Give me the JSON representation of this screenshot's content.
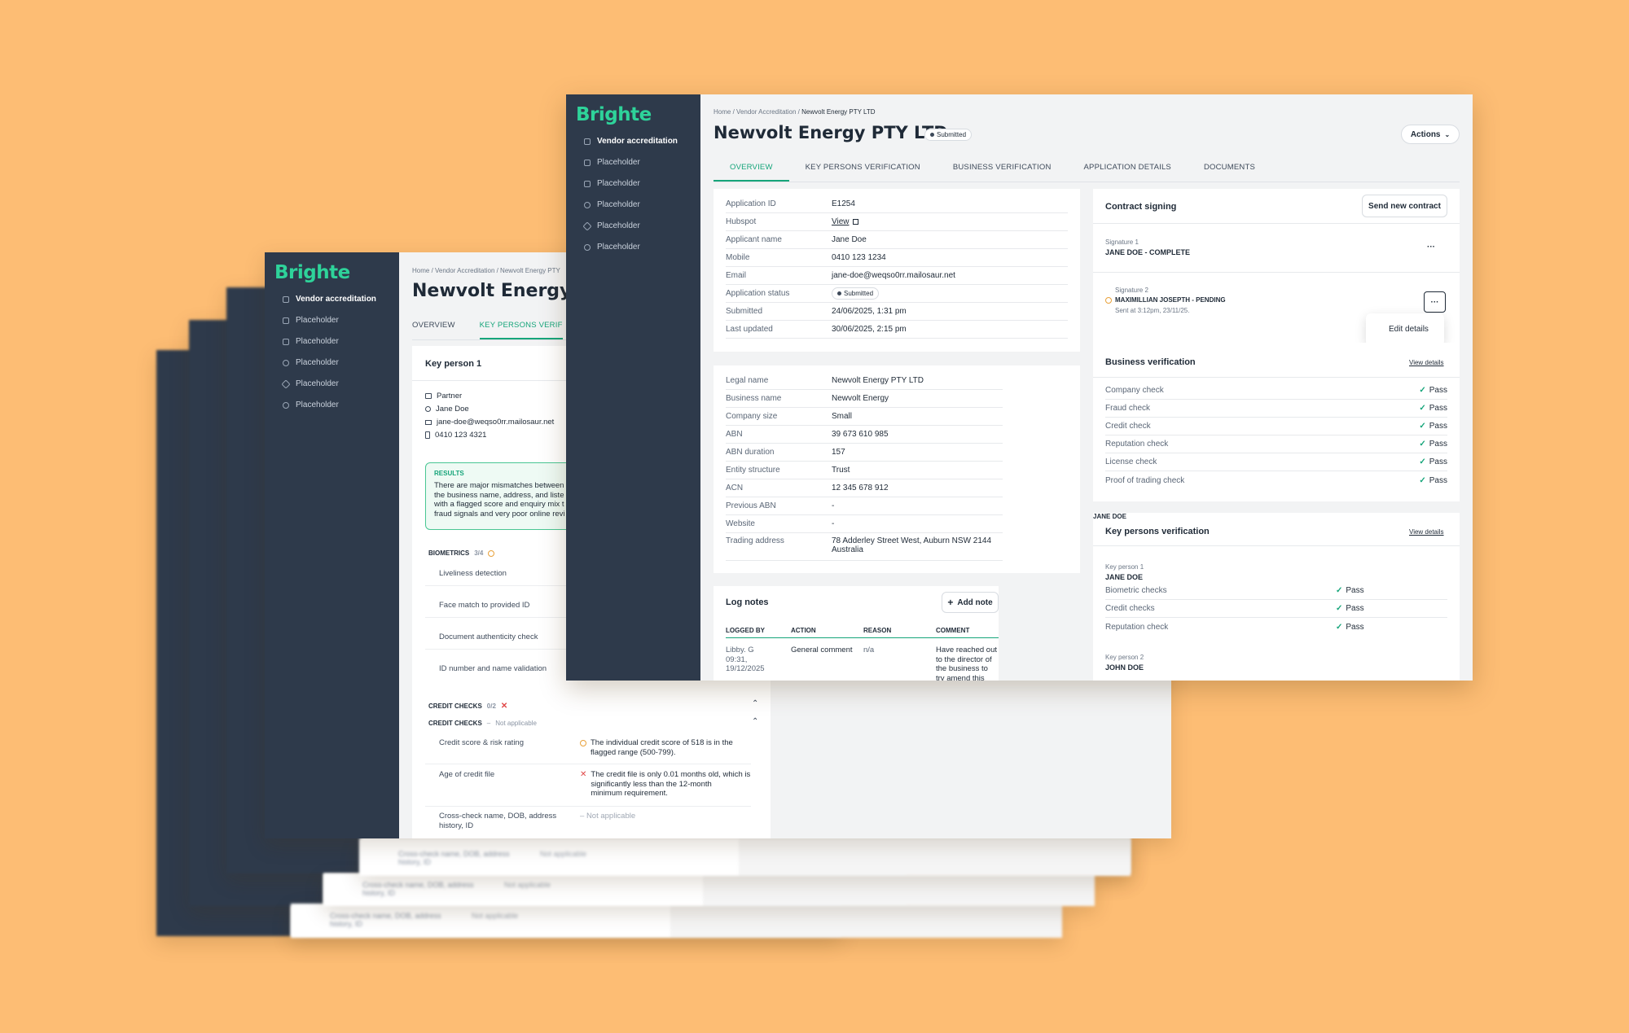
{
  "brand": {
    "logo": "Brighte",
    "accent": "#16a57a",
    "sidebar_bg": "#2e3a4b",
    "background": "#fdbd74"
  },
  "sidebar": {
    "items": [
      {
        "label": "Vendor accreditation",
        "icon": "shield-icon"
      },
      {
        "label": "Placeholder",
        "icon": "box-icon"
      },
      {
        "label": "Placeholder",
        "icon": "document-icon"
      },
      {
        "label": "Placeholder",
        "icon": "user-icon"
      },
      {
        "label": "Placeholder",
        "icon": "sparkle-icon"
      },
      {
        "label": "Placeholder",
        "icon": "settings-icon"
      }
    ]
  },
  "main": {
    "breadcrumb": {
      "home": "Home",
      "section": "Vendor Accreditation",
      "current": "Newvolt Energy PTY LTD",
      "sep": "/"
    },
    "title": "Newvolt Energy PTY LTD",
    "status_badge": "Submitted",
    "actions_label": "Actions",
    "tabs": [
      {
        "label": "OVERVIEW"
      },
      {
        "label": "KEY PERSONS VERIFICATION"
      },
      {
        "label": "BUSINESS VERIFICATION"
      },
      {
        "label": "APPLICATION DETAILS"
      },
      {
        "label": "DOCUMENTS"
      }
    ],
    "application": {
      "rows": [
        {
          "k": "Application ID",
          "v": "E1254"
        },
        {
          "k": "Hubspot",
          "v": "View"
        },
        {
          "k": "Applicant name",
          "v": "Jane Doe"
        },
        {
          "k": "Mobile",
          "v": "0410 123 1234"
        },
        {
          "k": "Email",
          "v": "jane-doe@weqso0rr.mailosaur.net"
        },
        {
          "k": "Application status",
          "v": "Submitted"
        },
        {
          "k": "Submitted",
          "v": "24/06/2025, 1:31 pm"
        },
        {
          "k": "Last updated",
          "v": "30/06/2025, 2:15 pm"
        }
      ]
    },
    "business": {
      "rows": [
        {
          "k": "Legal name",
          "v": "Newvolt Energy PTY LTD"
        },
        {
          "k": "Business name",
          "v": "Newvolt Energy"
        },
        {
          "k": "Company size",
          "v": "Small"
        },
        {
          "k": "ABN",
          "v": "39 673 610 985"
        },
        {
          "k": "ABN duration",
          "v": "157"
        },
        {
          "k": "Entity structure",
          "v": "Trust"
        },
        {
          "k": "ACN",
          "v": "12 345 678 912"
        },
        {
          "k": "Previous ABN",
          "v": "-"
        },
        {
          "k": "Website",
          "v": "-"
        },
        {
          "k": "Trading address",
          "v": "78 Adderley Street West, Auburn NSW 2144",
          "v2": "Australia"
        }
      ]
    },
    "log_notes": {
      "title": "Log notes",
      "add_label": "Add note",
      "headers": [
        "LOGGED BY",
        "ACTION",
        "REASON",
        "COMMENT"
      ],
      "row": {
        "by": "Libby. G",
        "by_time": "09:31,",
        "by_date": "19/12/2025",
        "action": "General comment",
        "reason": "n/a",
        "comment1": "Have reached out",
        "comment2": "to the director of",
        "comment3": "the business to",
        "comment4": "try amend this"
      }
    },
    "contract": {
      "title": "Contract signing",
      "send_label": "Send new contract",
      "sig1_label": "Signature 1",
      "sig1_value": "JANE DOE - COMPLETE",
      "sig2_label": "Signature 2",
      "sig2_value": "MAXIMILLIAN JOSEPTH - PENDING",
      "sig2_sent": "Sent at 3:12pm, 23/11/25.",
      "more": "···",
      "menu_item": "Edit details"
    },
    "business_verification": {
      "title": "Business verification",
      "link": "View details",
      "checks": [
        {
          "label": "Company check",
          "result": "Pass"
        },
        {
          "label": "Fraud check",
          "result": "Pass"
        },
        {
          "label": "Credit check",
          "result": "Pass"
        },
        {
          "label": "Reputation check",
          "result": "Pass"
        },
        {
          "label": "License check",
          "result": "Pass"
        },
        {
          "label": "Proof of trading check",
          "result": "Pass"
        }
      ]
    },
    "key_persons": {
      "title": "Key persons verification",
      "link": "View details",
      "kp1_label": "Key person 1",
      "kp1_name": "JANE DOE",
      "checks": [
        {
          "label": "Biometric checks",
          "result": "Pass"
        },
        {
          "label": "Credit checks",
          "result": "Pass"
        },
        {
          "label": "Reputation check",
          "result": "Pass"
        }
      ],
      "kp2_label": "Key person 2",
      "kp2_name": "JOHN DOE"
    }
  },
  "second": {
    "breadcrumb": "Home / Vendor Accreditation / Newvolt Energy PTY",
    "title": "Newvolt Energy PT",
    "tabs": [
      "OVERVIEW",
      "KEY PERSONS VERIF"
    ],
    "key_person_title": "Key person 1",
    "kp_details": [
      {
        "icon": "briefcase-icon",
        "text": "Partner"
      },
      {
        "icon": "user-icon",
        "text": "Jane Doe"
      },
      {
        "icon": "mail-icon",
        "text": "jane-doe@weqso0rr.mailosaur.net"
      },
      {
        "icon": "phone-icon",
        "text": "0410 123 4321"
      }
    ],
    "results_label": "RESULTS",
    "results_lines": [
      "There are major mismatches between",
      "the business name, address, and liste",
      "with a flagged score and enquiry mix t",
      "fraud signals and very poor online revi"
    ],
    "biometrics_label": "BIOMETRICS",
    "biometrics_count": "3/4",
    "biometric_items": [
      "Liveliness detection",
      "Face match to provided ID",
      "Document authenticity check",
      "ID number and name validation"
    ],
    "credit_checks_1": {
      "label": "CREDIT CHECKS",
      "count": "0/2"
    },
    "credit_checks_2": {
      "label": "CREDIT CHECKS",
      "note": "Not applicable"
    },
    "credit_rows": [
      {
        "k": "Credit score & risk rating",
        "v1": "The individual credit score of 518 is in the",
        "v2": "flagged range (500-799).",
        "v3": ""
      },
      {
        "k": "Age of credit file",
        "v1": "The credit file is only 0.01 months old, which is",
        "v2": "significantly less than the 12-month",
        "v3": "minimum requirement."
      },
      {
        "k": "Cross-check name, DOB, address",
        "k2": "history, ID",
        "v1": "Not applicable",
        "v2": "",
        "v3": ""
      }
    ]
  },
  "back_layers": {
    "row_text": "Cross-check name, DOB, address",
    "row_text2": "history, ID",
    "row_value": "Not applicable"
  }
}
